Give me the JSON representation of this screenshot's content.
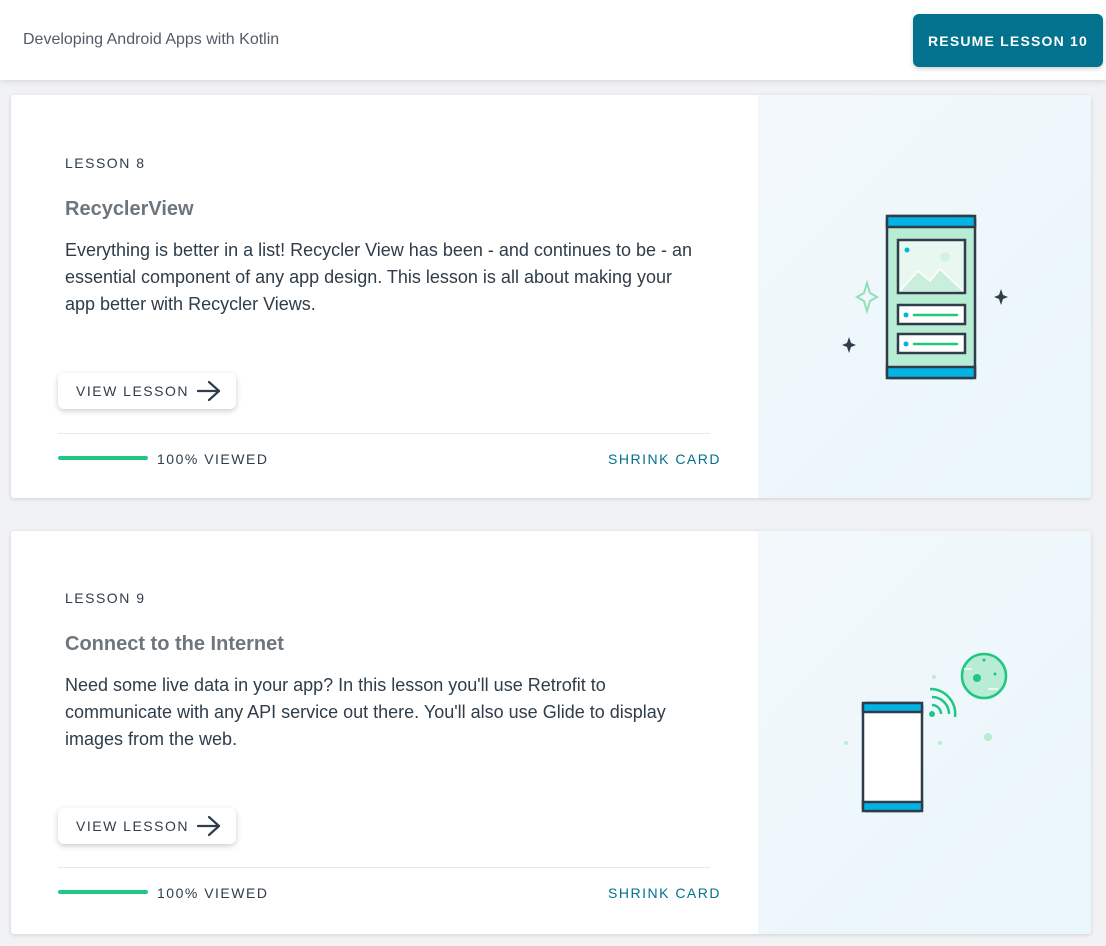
{
  "header": {
    "course_title": "Developing Android Apps with Kotlin",
    "resume_label": "RESUME LESSON 10"
  },
  "colors": {
    "accent": "#02728e",
    "progress": "#1fc780",
    "card_art_background": "#eef7fb"
  },
  "lessons": [
    {
      "number_label": "LESSON 8",
      "title": "RecyclerView",
      "description": "Everything is better in a list! Recycler View has been - and continues to be - an essential component of any app design. This lesson is all about making your app better with Recycler Views.",
      "view_label": "VIEW LESSON",
      "progress_fraction": 1.0,
      "viewed_label": "100% VIEWED",
      "shrink_label": "SHRINK CARD",
      "illustration": "phone-list-illustration"
    },
    {
      "number_label": "LESSON 9",
      "title": "Connect to the Internet",
      "description": "Need some live data in your app? In this lesson you'll use Retrofit to communicate with any API service out there. You'll also use Glide to display images from the web.",
      "view_label": "VIEW LESSON",
      "progress_fraction": 1.0,
      "viewed_label": "100% VIEWED",
      "shrink_label": "SHRINK CARD",
      "illustration": "phone-internet-illustration"
    }
  ]
}
